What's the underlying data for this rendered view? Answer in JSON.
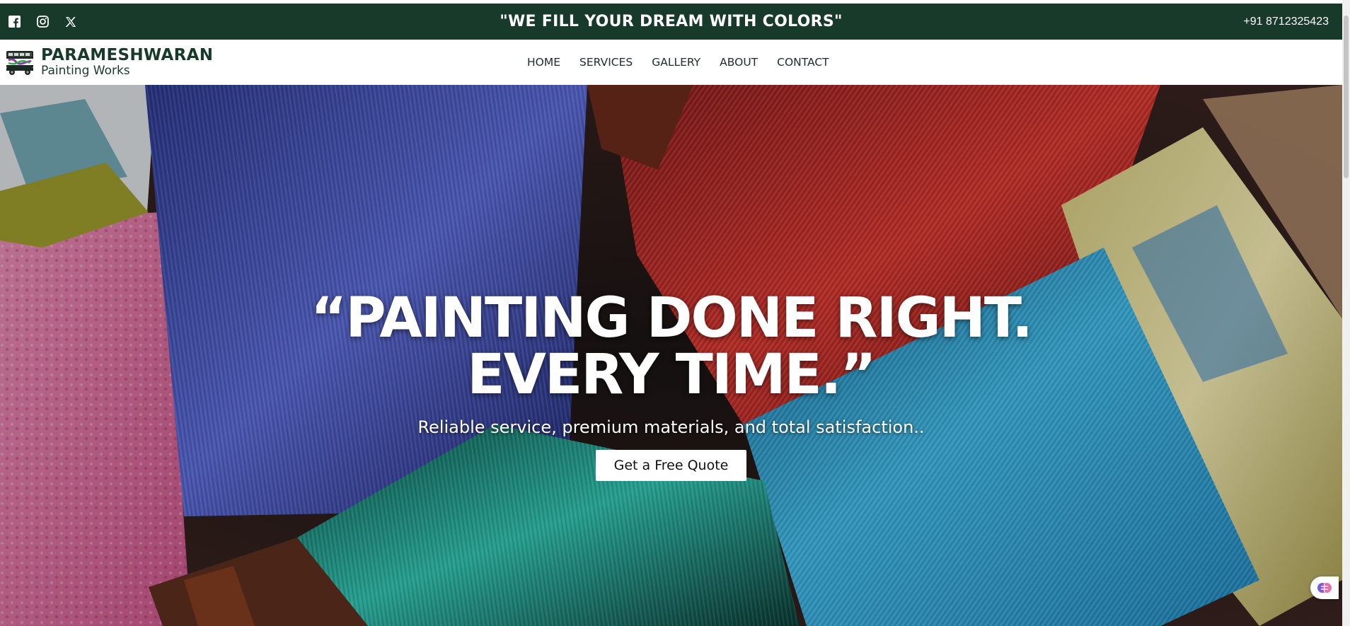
{
  "topbar": {
    "tagline": "\"WE FILL YOUR DREAM WITH COLORS\"",
    "phone": "+91 8712325423",
    "social_icons": [
      "facebook-icon",
      "instagram-icon",
      "x-icon"
    ],
    "bg_color": "#183a2b"
  },
  "brand": {
    "title": "PARAMESHWARAN",
    "subtitle": "Painting Works",
    "color": "#183a2b"
  },
  "nav": {
    "items": [
      {
        "label": "HOME"
      },
      {
        "label": "SERVICES"
      },
      {
        "label": "GALLERY"
      },
      {
        "label": "ABOUT"
      },
      {
        "label": "CONTACT"
      }
    ]
  },
  "hero": {
    "headline_line1": "“PAINTING DONE RIGHT.",
    "headline_line2": "EVERY TIME.”",
    "subtitle": "Reliable service, premium materials, and total satisfaction..",
    "cta_label": "Get a Free Quote",
    "background": "paint-brushes-photo"
  }
}
